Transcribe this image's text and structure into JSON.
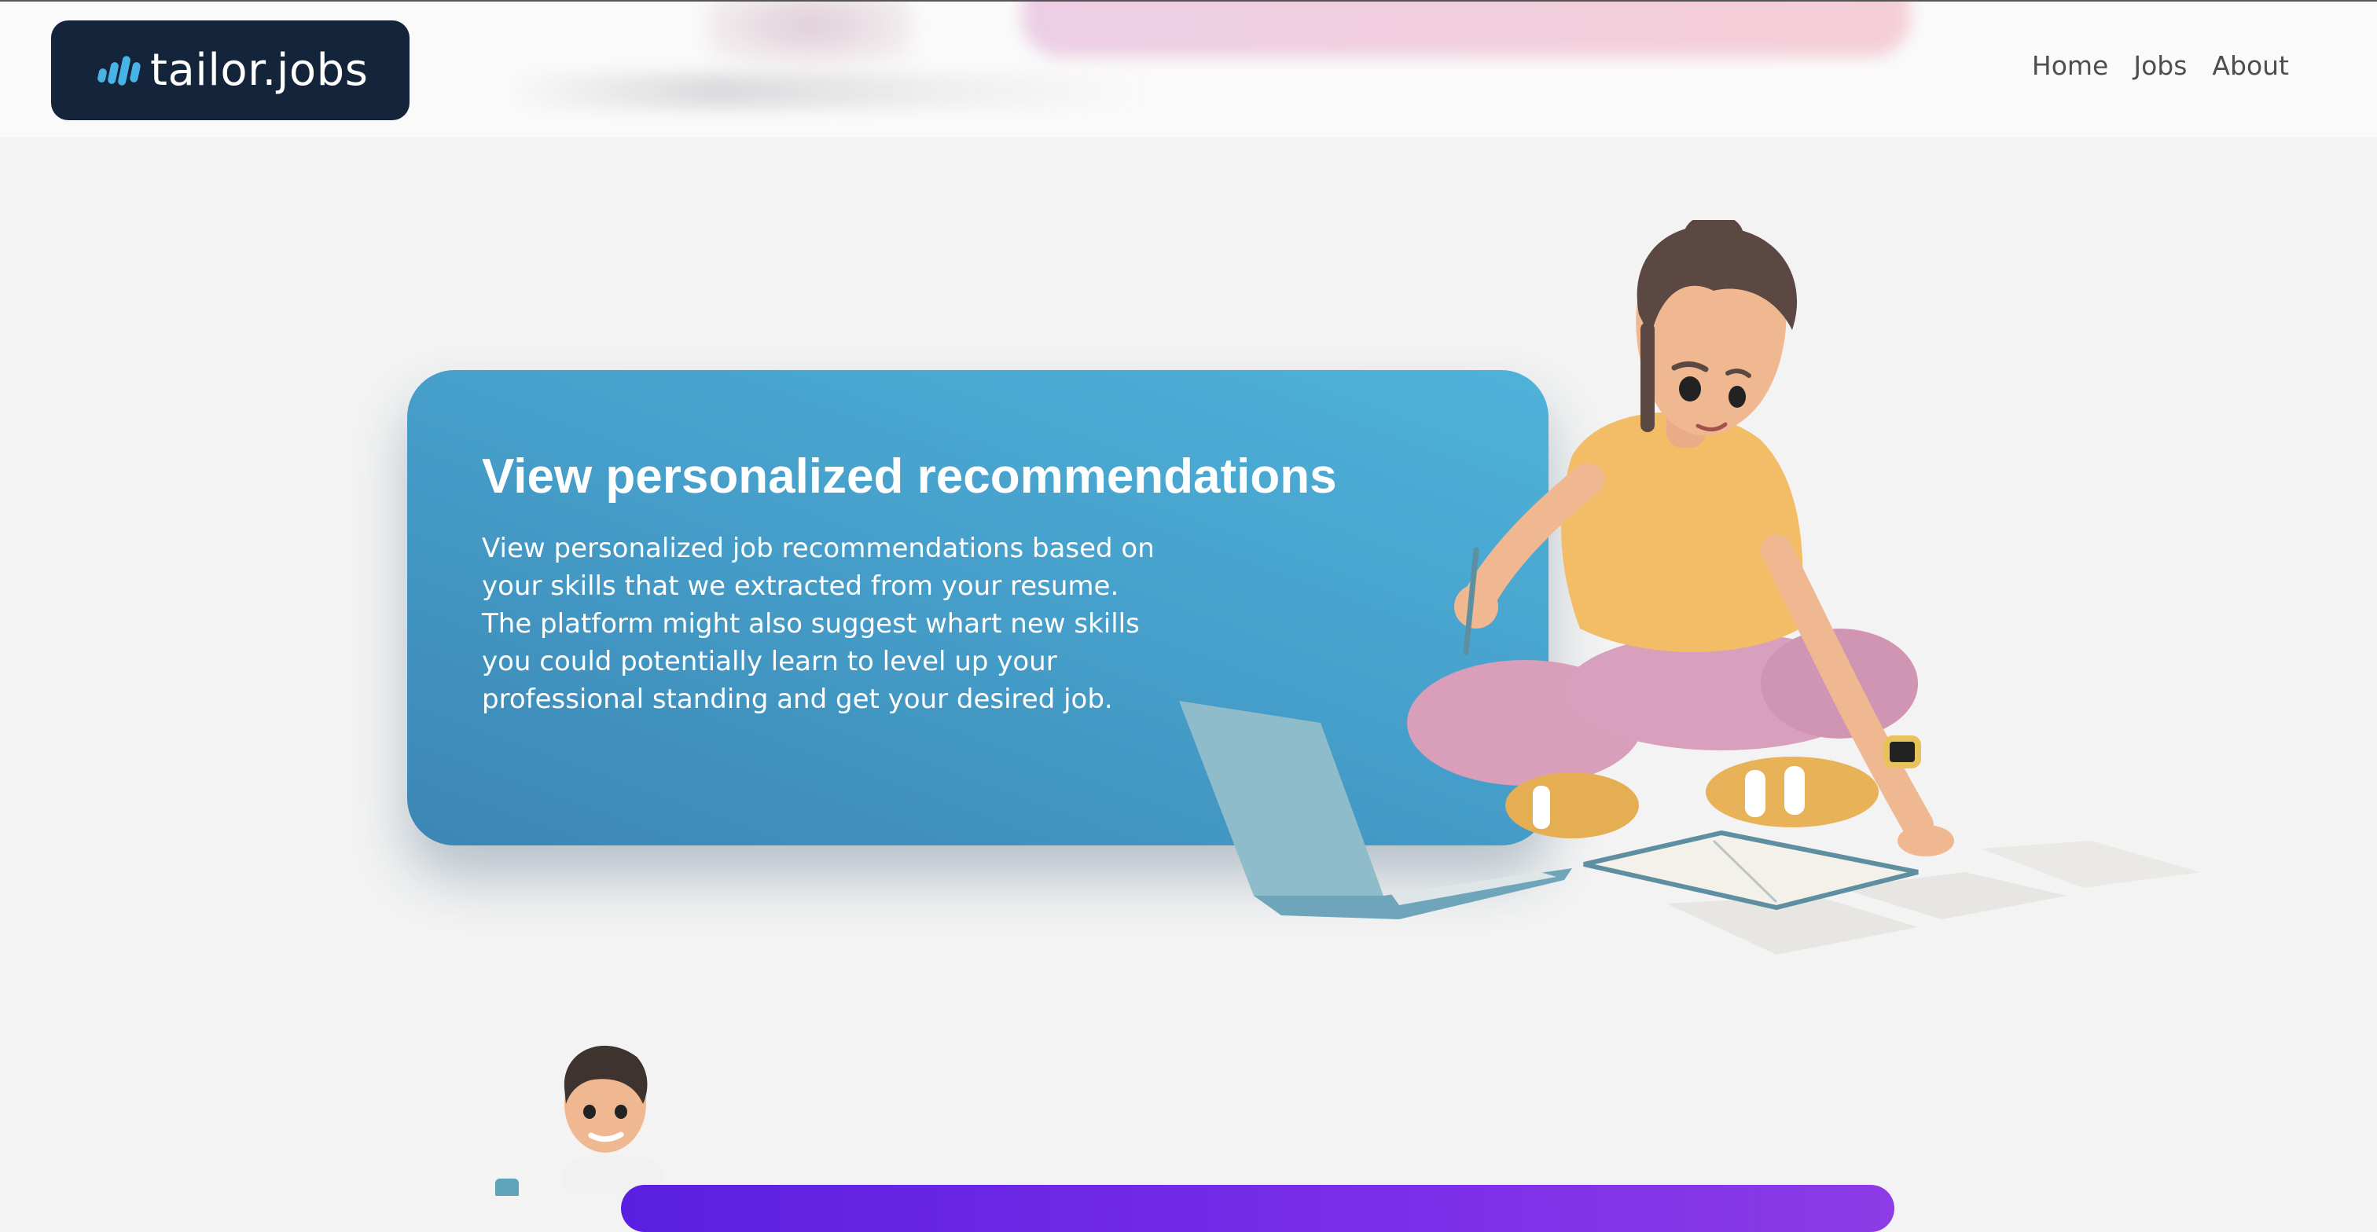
{
  "header": {
    "logo_text": "tailor.jobs",
    "logo_icon": "sound-bars-logo-icon",
    "nav": [
      {
        "label": "Home"
      },
      {
        "label": "Jobs"
      },
      {
        "label": "About"
      }
    ]
  },
  "hero": {
    "title": "View personalized recommendations",
    "body": "View personalized job recommendations based on your skills that we extracted from your resume. The platform might also suggest whart new skills you could potentially learn to level up your professional standing and get your desired job.",
    "illustration": "girl-with-laptop-illustration"
  },
  "next_section": {
    "illustration": "boy-with-phone-illustration"
  },
  "colors": {
    "logo_bg": "#14243b",
    "logo_accent": "#4ab3e6",
    "card_gradient_start": "#4fb2d9",
    "card_gradient_end": "#3c86b4",
    "next_card": "#6a28e5",
    "page_bg": "#f3f3f3"
  }
}
